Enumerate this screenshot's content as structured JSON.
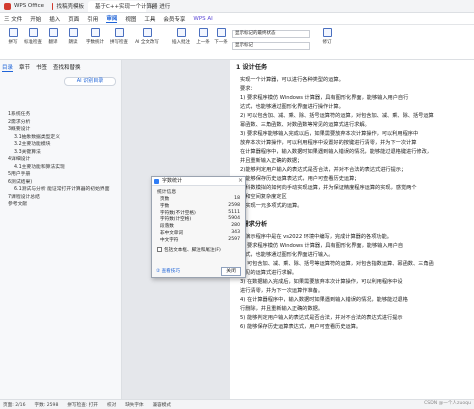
{
  "tabs": {
    "office": "WPS Office",
    "templates": "找稿壳模板",
    "doc": "基于C++实现一个计算器 进行",
    "new": "+"
  },
  "menu": {
    "file": "三 文件",
    "start": "开始",
    "insert": "插入",
    "page": "页面",
    "references": "引用",
    "review": "审阅",
    "view": "视图",
    "tools": "工具",
    "member": "会员专享",
    "wpsai": "WPS AI"
  },
  "ribbon": {
    "buttons": [
      "拼写",
      "标准检查",
      "翻译",
      "朗读",
      "字数统计",
      "拼写检查",
      "AI 全文改写",
      "插入批注",
      "上一条",
      "下一条",
      "修订"
    ],
    "dd1": "显示标记的最终状态",
    "dd2": "显示标记"
  },
  "nav": {
    "tabs": [
      "目录",
      "章节",
      "书签",
      "查找和替换"
    ],
    "ai_button": "AI 识别目录",
    "toc": [
      {
        "text": "1系统任务",
        "level": 1
      },
      {
        "text": "2需求分析",
        "level": 1
      },
      {
        "text": "3概要设计",
        "level": 1
      },
      {
        "text": "3.1抽象数据类型定义",
        "level": 2
      },
      {
        "text": "3.2主要功能模块",
        "level": 2
      },
      {
        "text": "3.3关键算法",
        "level": 2
      },
      {
        "text": "4详细设计",
        "level": 1
      },
      {
        "text": "4.1主要功能和算法实现",
        "level": 2
      },
      {
        "text": "5用户手册",
        "level": 1
      },
      {
        "text": "6测试结果)",
        "level": 1
      },
      {
        "text": "6.1测试与分析 能证常打开计算器的初始界面",
        "level": 2
      },
      {
        "text": "7课程设计总结",
        "level": 1
      },
      {
        "text": "参考文献",
        "level": 1
      }
    ]
  },
  "document": {
    "lines": [
      {
        "text": "1 设计任务",
        "h": true
      },
      {
        "text": "实现一个计算器，可以进行各种类型的运算。",
        "h": false
      },
      {
        "text": "要求：",
        "h": false
      },
      {
        "text": "1) 要求程序模仿 Windows 计算器，具有图形化界面，能够输入用户自行",
        "h": false
      },
      {
        "text": "达式，也能够通过图形化界面进行操作计算。",
        "h": false
      },
      {
        "text": "2) 可以包含加、减、乘、除、括号运算符的运算，对包含加、减、乘、除、括号运算",
        "h": false
      },
      {
        "text": "幂函数、三角函数、对数函数等常见的运算式进行求解。",
        "h": false
      },
      {
        "text": "3) 要求程序能够输入完成以后，如果需要放弃本次计算操作，可以利用程序中",
        "h": false
      },
      {
        "text": "放弃本次计算操作，可以利用程序中设置好的按键进行清零，并为下一次计算",
        "h": false
      },
      {
        "text": "在计算器程序中，输入数据时如果遇到输入错误的情况，能够能过退格键进行修改，",
        "h": false
      },
      {
        "text": "并且重新输入正确的数据；",
        "h": false
      },
      {
        "text": "2)能够判定用户输入的表达式是否合法，并对不合法的表达式进行提示；",
        "h": false
      },
      {
        "text": "3)能够保存历史运算表达式，用户可查看历史运算；",
        "h": false
      },
      {
        "text": "4)科数模拟的如何向手动实现运算，并为保证精度程序运算的实现，感觉两个",
        "h": false
      },
      {
        "text": "度和空间复杂度定区",
        "h": false
      },
      {
        "text": "5)实现一元多项式的运算。",
        "h": false
      },
      {
        "text": "2 需求分析",
        "h": true
      },
      {
        "text": "本演示程序中是在 vs2022 环境中编写，完成计算器的各项功能。",
        "h": false
      },
      {
        "text": "1) 要求程序模仿 Windows 计算器，具有图形化界面，能够输入用户自",
        "h": false
      },
      {
        "text": "达式，也能够通过图形化界面进行输入。",
        "h": false
      },
      {
        "text": "2) 可包含加、减、乘、除、括号等运算符的运算，对包含指数运算、幂函数、三角函",
        "h": false
      },
      {
        "text": "常见的运算式进行求解。",
        "h": false
      },
      {
        "text": "3) 在数据输入完成后，如果需要放弃本次计算操作，可以利用程序中设",
        "h": false
      },
      {
        "text": "进行清零，并为下一次运算作准备。",
        "h": false
      },
      {
        "text": "4) 在计算器程序中，输入数据时如果遇到输入错误的情况，能够能过退格",
        "h": false
      },
      {
        "text": "行删除，并且重新输入正确的数据。",
        "h": false
      },
      {
        "text": "5) 能够判定用户输入的表达式是否合法，并对不合法的表达式进行提示",
        "h": false
      },
      {
        "text": "6) 能够保存历史运算表达式，用户可查看历史运算。",
        "h": false
      }
    ]
  },
  "dialog": {
    "title": "字数统计",
    "close_x": "×",
    "section": "统计信息",
    "stats": [
      {
        "label": "页数",
        "value": "18"
      },
      {
        "label": "字数",
        "value": "2598"
      },
      {
        "label": "字符数(不计空格)",
        "value": "5111"
      },
      {
        "label": "字符数(计空格)",
        "value": "5904"
      },
      {
        "label": "段落数",
        "value": "280"
      },
      {
        "label": "非中文单词",
        "value": "343"
      },
      {
        "label": "中文字符",
        "value": "2597"
      }
    ],
    "checkbox": "包括文本框、脚注和尾注(F)",
    "tips": "② 查看技巧",
    "close_btn": "关闭"
  },
  "status": {
    "page": "页面: 2/16",
    "words": "字数: 2598",
    "spell": "拼写检查: 打开",
    "proof": "校对",
    "missing": "缺失字体",
    "content": "兼容模式"
  },
  "watermark": "CSDN @一个人zuoqu"
}
